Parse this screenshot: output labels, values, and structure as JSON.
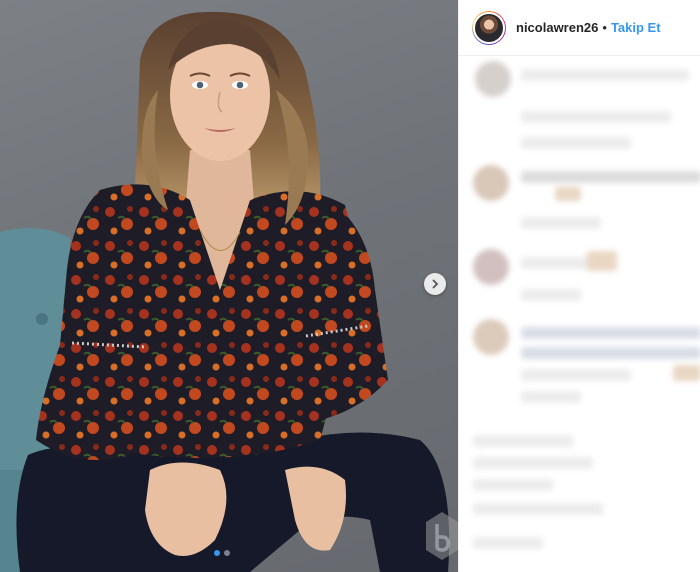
{
  "post_header": {
    "username": "nicolawren26",
    "separator": "•",
    "follow_label": "Takip Et"
  },
  "carousel": {
    "slide_count": 2,
    "active_index": 0
  },
  "colors": {
    "accent": "#3897f0",
    "username": "#262626",
    "background": "#ffffff"
  },
  "icons": [
    "chevron-right-icon",
    "watermark-logo"
  ]
}
